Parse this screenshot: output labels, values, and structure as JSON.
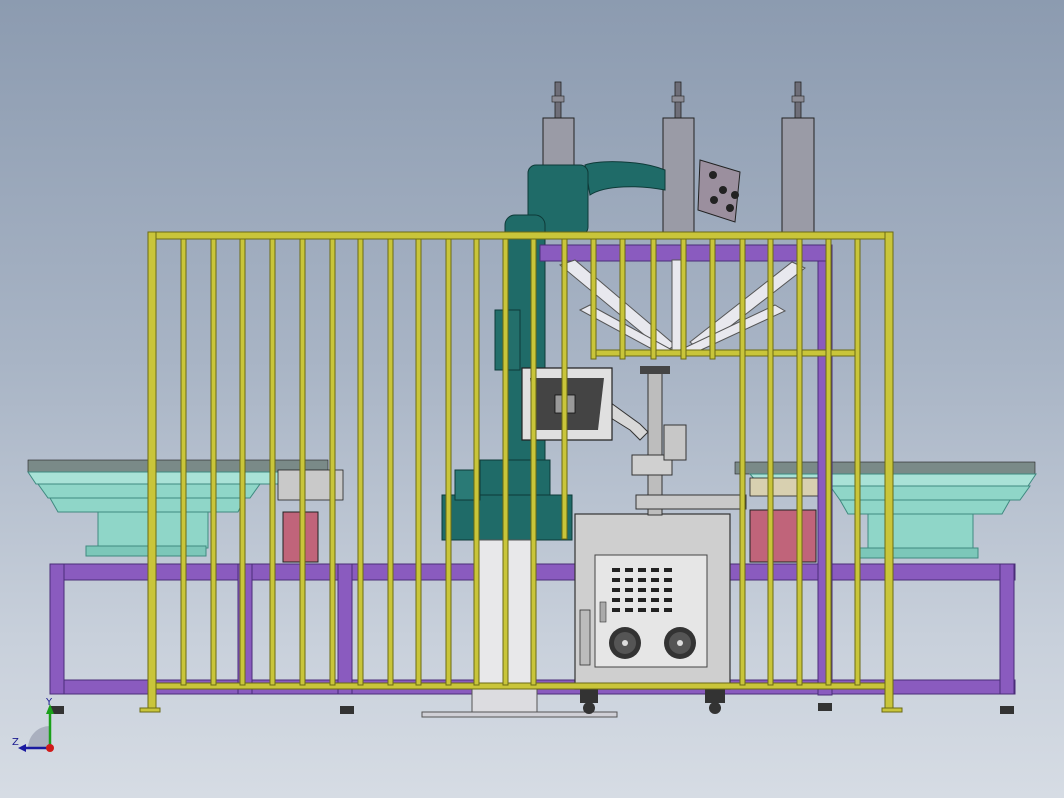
{
  "viewport": {
    "background_top": "#8c9bb0",
    "background_bottom": "#d6dce4"
  },
  "triad": {
    "x_label": "",
    "y_label": "Y",
    "z_label": "Z"
  },
  "colors": {
    "fence": "#c9c53a",
    "fence_dark": "#6b6a14",
    "frame": "#8a5bbf",
    "frame_dark": "#4a2d78",
    "robot": "#1f6b68",
    "robot_dark": "#0e3a38",
    "feeder": "#8fd6c8",
    "feeder_dark": "#3f8a80",
    "cabinet": "#cfcfcf",
    "pink_block": "#c0647a",
    "cylinder": "#9a9ba6"
  }
}
